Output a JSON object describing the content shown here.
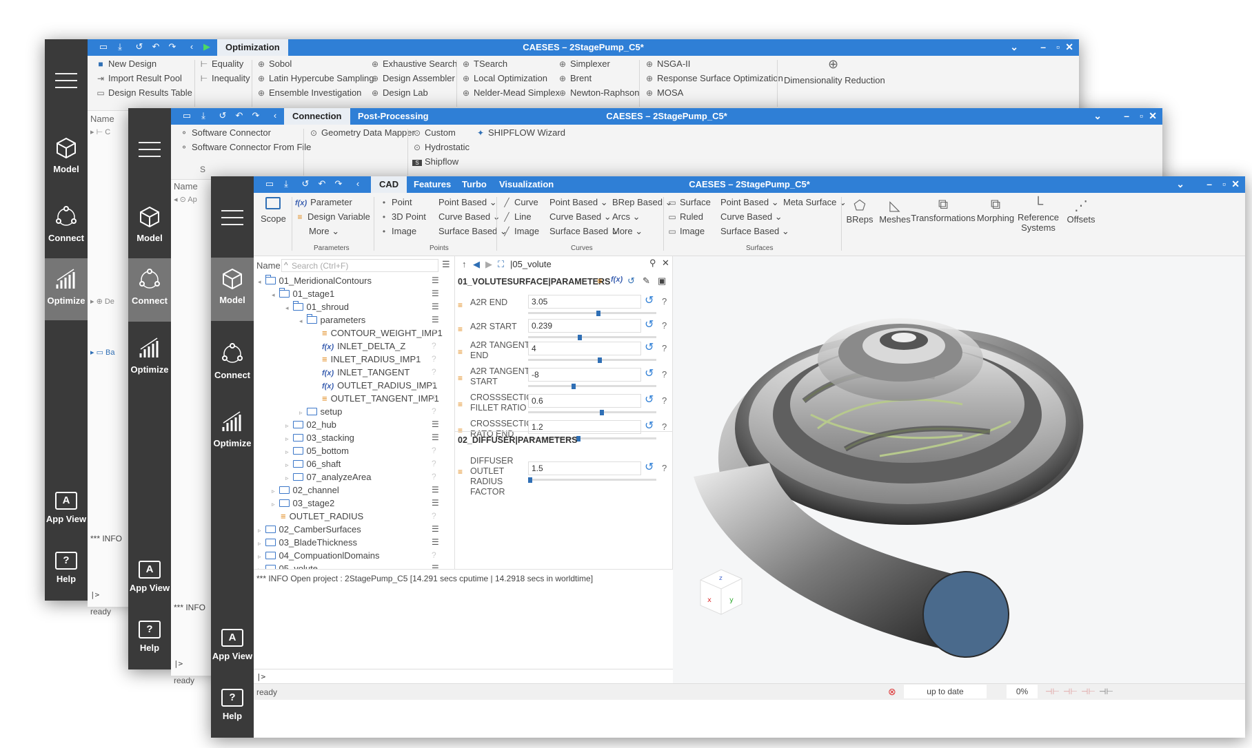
{
  "colors": {
    "titlebar": "#2f7fd6",
    "sidebar": "#3a3a3a",
    "sidebar_active": "#767676",
    "accent_orange": "#e08a1c",
    "folder_blue": "#3a76c8"
  },
  "app_title": "CAESES – 2StagePump_C5*",
  "sidebar": {
    "model": "Model",
    "connect": "Connect",
    "optimize": "Optimize",
    "appview": "App View",
    "help": "Help",
    "appview_glyph": "A",
    "help_glyph": "?"
  },
  "w1": {
    "tab": "Optimization",
    "items": [
      "New Design",
      "Import Result Pool",
      "Design Results Table",
      "Equality",
      "Inequality",
      "Sobol",
      "Latin Hypercube Sampling",
      "Ensemble Investigation",
      "Exhaustive Search",
      "Design Assembler",
      "Design Lab",
      "TSearch",
      "Local Optimization",
      "Nelder-Mead Simplex",
      "Simplexer",
      "Brent",
      "Newton-Raphson",
      "NSGA-II",
      "Response Surface Optimization",
      "MOSA",
      "Dimensionality Reduction"
    ],
    "name_header": "Name",
    "tree_items": [
      "C",
      "De",
      "Ba"
    ],
    "info": "*** INFO",
    "prompt": "|>",
    "status": "ready"
  },
  "w2": {
    "tabs": [
      "Connection",
      "Post-Processing"
    ],
    "items": [
      "Software Connector",
      "Software Connector From File",
      "Geometry Data Mapper",
      "Custom",
      "Hydrostatic",
      "Shipflow",
      "SHIPFLOW Wizard"
    ],
    "name_header": "Name",
    "tree_items": [
      "Ap"
    ],
    "col_s": "S",
    "info": "*** INFO",
    "prompt": "|>",
    "status": "ready"
  },
  "w3": {
    "tabs": [
      "CAD",
      "Features",
      "Turbo",
      "Visualization"
    ],
    "ribbon": {
      "scope": "Scope",
      "params": [
        "Parameter",
        "Design Variable",
        "More"
      ],
      "params_group": "Parameters",
      "points": [
        "Point",
        "3D Point",
        "Image",
        "Point Based",
        "Curve Based",
        "Surface Based"
      ],
      "points_group": "Points",
      "curves": [
        "Curve",
        "Line",
        "Image",
        "Point Based",
        "Curve Based",
        "Surface Based",
        "BRep Based",
        "Arcs",
        "More"
      ],
      "curves_group": "Curves",
      "surfaces": [
        "Surface",
        "Ruled",
        "Image",
        "Point Based",
        "Curve Based",
        "Surface Based",
        "Meta Surface"
      ],
      "surfaces_group": "Surfaces",
      "big": [
        "BReps",
        "Meshes",
        "Transformations",
        "Morphing",
        "Reference Systems",
        "Offsets"
      ]
    },
    "tree": {
      "name_header": "Name",
      "search_placeholder": "Search (Ctrl+F)",
      "rows": [
        {
          "label": "01_MeridionalContours",
          "type": "folder"
        },
        {
          "label": "01_stage1",
          "type": "folder"
        },
        {
          "label": "01_shroud",
          "type": "folder"
        },
        {
          "label": "parameters",
          "type": "folder"
        },
        {
          "label": "CONTOUR_WEIGHT_IMP1",
          "type": "param"
        },
        {
          "label": "INLET_DELTA_Z",
          "type": "fx"
        },
        {
          "label": "INLET_RADIUS_IMP1",
          "type": "param"
        },
        {
          "label": "INLET_TANGENT",
          "type": "fx"
        },
        {
          "label": "OUTLET_RADIUS_IMP1",
          "type": "fx"
        },
        {
          "label": "OUTLET_TANGENT_IMP1",
          "type": "param"
        },
        {
          "label": "setup",
          "type": "folder"
        },
        {
          "label": "02_hub",
          "type": "folder"
        },
        {
          "label": "03_stacking",
          "type": "folder"
        },
        {
          "label": "05_bottom",
          "type": "folder"
        },
        {
          "label": "06_shaft",
          "type": "folder"
        },
        {
          "label": "07_analyzeArea",
          "type": "folder"
        },
        {
          "label": "02_channel",
          "type": "folder"
        },
        {
          "label": "03_stage2",
          "type": "folder"
        },
        {
          "label": "OUTLET_RADIUS",
          "type": "param"
        },
        {
          "label": "02_CamberSurfaces",
          "type": "folder"
        },
        {
          "label": "03_BladeThickness",
          "type": "folder"
        },
        {
          "label": "04_CompuationlDomains",
          "type": "folder"
        },
        {
          "label": "05_volute",
          "type": "folder"
        }
      ]
    },
    "params": {
      "path": "|05_volute",
      "section1": "01_VOLUTESURFACE|PARAMETERS",
      "section2": "02_DIFFUSER|PARAMETERS",
      "fx_label": "f(x)",
      "rows": [
        {
          "label": "A2R END",
          "value": "3.05",
          "pos": 0.55
        },
        {
          "label": "A2R START",
          "value": "0.239",
          "pos": 0.4
        },
        {
          "label": "A2R TANGENT END",
          "value": "4",
          "pos": 0.56
        },
        {
          "label": "A2R TANGENT START",
          "value": "-8",
          "pos": 0.35
        },
        {
          "label": "CROSSSECTION FILLET RATIO",
          "value": "0.6",
          "pos": 0.58
        },
        {
          "label": "CROSSSECTION RATO END",
          "value": "1.2",
          "pos": 0.39
        },
        {
          "label": "DIFFUSER OUTLET RADIUS FACTOR",
          "value": "1.5",
          "pos": 0.0
        }
      ]
    },
    "console": "*** INFO Open project : 2StagePump_C5 [14.291 secs cputime  |  14.2918 secs in worldtime]",
    "prompt": "|>",
    "status": "ready",
    "status_right": "up to date",
    "progress": "0%"
  }
}
